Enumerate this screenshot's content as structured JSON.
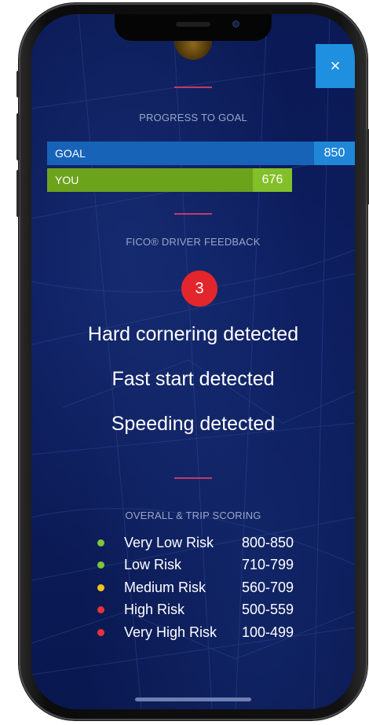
{
  "close": {
    "label": "×"
  },
  "progress": {
    "title": "PROGRESS TO GOAL",
    "goal_label": "GOAL",
    "goal_value": "850",
    "you_label": "YOU",
    "you_value": "676",
    "you_fraction": 0.795
  },
  "feedback": {
    "title": "FICO® DRIVER FEEDBACK",
    "count": "3",
    "items": [
      "Hard cornering detected",
      "Fast start detected",
      "Speeding detected"
    ]
  },
  "scoring": {
    "title": "OVERALL & TRIP SCORING",
    "levels": [
      {
        "label": "Very Low Risk",
        "range": "800-850",
        "color": "#7cc63a"
      },
      {
        "label": "Low Risk",
        "range": "710-799",
        "color": "#7cc63a"
      },
      {
        "label": "Medium Risk",
        "range": "560-709",
        "color": "#f2c418"
      },
      {
        "label": "High Risk",
        "range": "500-559",
        "color": "#e8333a"
      },
      {
        "label": "Very High Risk",
        "range": "100-499",
        "color": "#e8333a"
      }
    ]
  }
}
